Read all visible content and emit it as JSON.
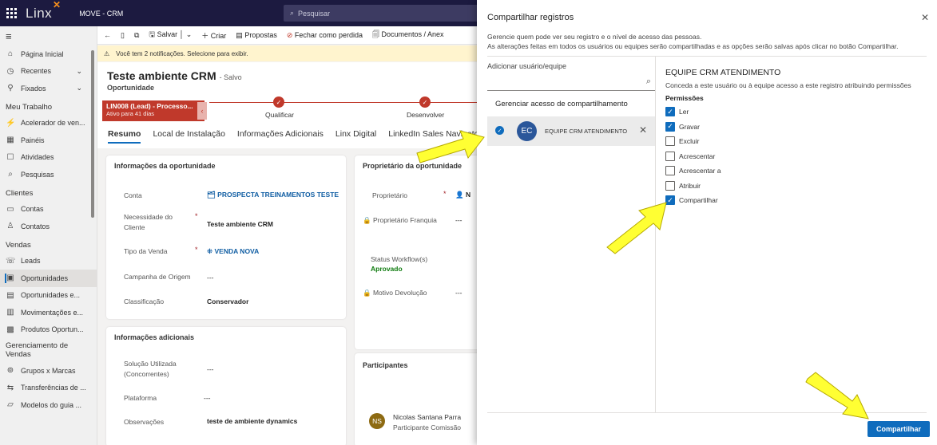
{
  "topbar": {
    "brand": "Linx",
    "app_name": "MOVE - CRM",
    "search_placeholder": "Pesquisar"
  },
  "sidebar": {
    "top_items": [
      {
        "label": "Página Inicial",
        "icon": "home-icon"
      },
      {
        "label": "Recentes",
        "icon": "clock-icon"
      },
      {
        "label": "Fixados",
        "icon": "pin-icon"
      }
    ],
    "groups": [
      {
        "title": "Meu Trabalho",
        "items": [
          "Acelerador de ven...",
          "Painéis",
          "Atividades",
          "Pesquisas"
        ]
      },
      {
        "title": "Clientes",
        "items": [
          "Contas",
          "Contatos"
        ]
      },
      {
        "title": "Vendas",
        "items": [
          "Leads",
          "Oportunidades",
          "Oportunidades e...",
          "Movimentações e...",
          "Produtos Oportun..."
        ]
      },
      {
        "title": "Gerenciamento de Vendas",
        "items": [
          "Grupos x Marcas",
          "Transferências de ...",
          "Modelos do guia ..."
        ]
      }
    ],
    "active_item": "Oportunidades"
  },
  "commandbar": {
    "save": "Salvar",
    "create": "Criar",
    "proposals": "Propostas",
    "close_lost": "Fechar como perdida",
    "documents": "Documentos / Anex"
  },
  "notification": "Você tem 2 notificações. Selecione para exibir.",
  "record": {
    "title": "Teste ambiente CRM",
    "saved": "- Salvo",
    "entity": "Oportunidade",
    "bpf": {
      "stage": "LIN008 (Lead) - Processo...",
      "active": "Ativo para 41 dias",
      "stages": [
        "Qualificar",
        "Desenvolver"
      ]
    },
    "tabs": [
      "Resumo",
      "Local de Instalação",
      "Informações Adicionais",
      "Linx Digital",
      "LinkedIn Sales Navigator"
    ]
  },
  "card_oportunidade": {
    "title": "Informações da oportunidade",
    "fields": [
      {
        "label": "Conta",
        "value": "PROSPECTA TREINAMENTOS TESTE"
      },
      {
        "label": "Necessidade do Cliente",
        "value": "Teste ambiente CRM"
      },
      {
        "label": "Tipo da Venda",
        "value": "VENDA NOVA"
      },
      {
        "label": "Campanha de Origem",
        "value": "---"
      },
      {
        "label": "Classificação",
        "value": "Conservador"
      }
    ]
  },
  "card_adicionais": {
    "title": "Informações adicionais",
    "fields": [
      {
        "label": "Solução Utilizada (Concorrentes)",
        "value": "---"
      },
      {
        "label": "Plataforma",
        "value": "---"
      },
      {
        "label": "Observações",
        "value": "teste de ambiente dynamics"
      }
    ]
  },
  "card_proprietario": {
    "title": "Proprietário da oportunidade",
    "owner_label": "Proprietário",
    "owner_value": "N",
    "franchise_label": "Proprietário Franquia",
    "franchise_value": "---",
    "workflow_label": "Status Workflow(s)",
    "workflow_value": "Aprovado",
    "return_label": "Motivo Devolução",
    "return_value": "---"
  },
  "card_participantes": {
    "title": "Participantes",
    "initials": "NS",
    "name": "Nicolas Santana Parra",
    "role": "Participante Comissão"
  },
  "share_panel": {
    "title": "Compartilhar registros",
    "desc1": "Gerencie quem pode ver seu registro e o nível de acesso das pessoas.",
    "desc2": "As alterações feitas em todos os usuários ou equipes serão compartilhadas e as opções serão salvas após clicar no botão Compartilhar.",
    "add_label": "Adicionar usuário/equipe",
    "manage_label": "Gerenciar acesso de compartilhamento",
    "member": {
      "initials": "EC",
      "name": "EQUIPE CRM ATENDIMENTO"
    },
    "team_title": "EQUIPE CRM ATENDIMENTO",
    "team_desc": "Conceda a este usuário ou à equipe acesso a este registro atribuindo permissões",
    "permissions_title": "Permissões",
    "permissions": [
      {
        "label": "Ler",
        "checked": true
      },
      {
        "label": "Gravar",
        "checked": true
      },
      {
        "label": "Excluir",
        "checked": false
      },
      {
        "label": "Acrescentar",
        "checked": false
      },
      {
        "label": "Acrescentar a",
        "checked": false
      },
      {
        "label": "Atribuir",
        "checked": false
      },
      {
        "label": "Compartilhar",
        "checked": true
      }
    ],
    "share_button": "Compartilhar"
  },
  "colors": {
    "topbar": "#1c1a40",
    "accent": "#0f6cbd",
    "bpf": "#c0392b",
    "arrow": "#ffff33"
  }
}
